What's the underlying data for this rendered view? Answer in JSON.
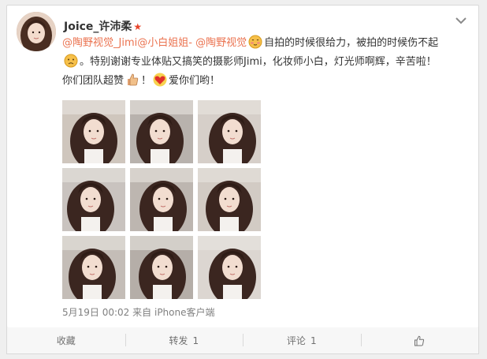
{
  "post": {
    "username": "Joice_许沛柔",
    "text": {
      "mention1": "@陶野视觉_Jimi",
      "mention2": "@小白姐姐-",
      "mention3": "@陶野视觉",
      "part1": "自拍的时候很给力，被拍的时候伤不起",
      "part2": "。特别谢谢专业体贴又搞笑的摄影师Jimi，化妆师小白，灯光师啊辉，辛苦啦！",
      "part3": "你们团队超赞",
      "part4": "！",
      "part5": "爱你们哟！"
    },
    "photo_count": 9,
    "date": "5月19日 00:02",
    "from_label": "来自",
    "source": "iPhone客户端"
  },
  "actions": {
    "favorite": "收藏",
    "repost": "转发",
    "repost_count": "1",
    "comment": "评论",
    "comment_count": "1"
  },
  "icons": {
    "vip": "vip-star-icon",
    "options": "chevron-down-icon",
    "like": "thumbs-up-icon",
    "emoji1": "blushing-face-emoji",
    "emoji2": "frowning-face-emoji",
    "emoji3": "thumbs-up-emoji",
    "emoji4": "heart-emoji"
  },
  "colors": {
    "mention": "#eb7350",
    "vip_star": "#e8442a",
    "text": "#333333",
    "meta": "#808080"
  }
}
